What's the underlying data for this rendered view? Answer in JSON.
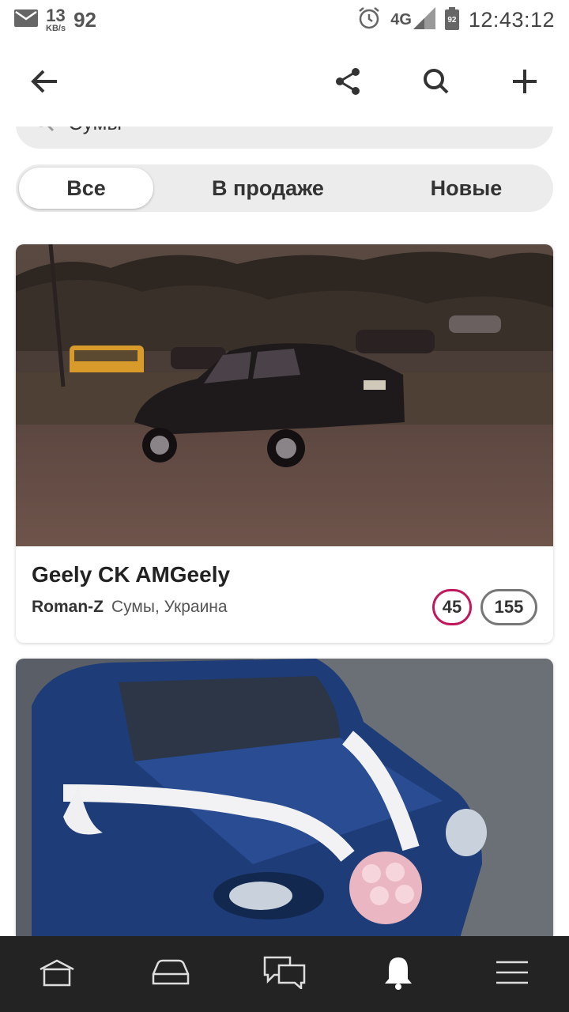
{
  "status_bar": {
    "net_speed_value": "13",
    "net_speed_unit": "KB/s",
    "notification_count": "92",
    "network": "4G",
    "battery": "92",
    "time": "12:43:12"
  },
  "search": {
    "value": "Сумы"
  },
  "tabs": [
    {
      "label": "Все",
      "active": true
    },
    {
      "label": "В продаже",
      "active": false
    },
    {
      "label": "Новые",
      "active": false
    }
  ],
  "cards": [
    {
      "title": "Geely CK AMGeely",
      "author": "Roman-Z",
      "location": "Сумы, Украина",
      "likes": "45",
      "comments": "155"
    }
  ],
  "colors": {
    "accent_likes": "#c2185b",
    "bottom_nav_bg": "#232323"
  }
}
